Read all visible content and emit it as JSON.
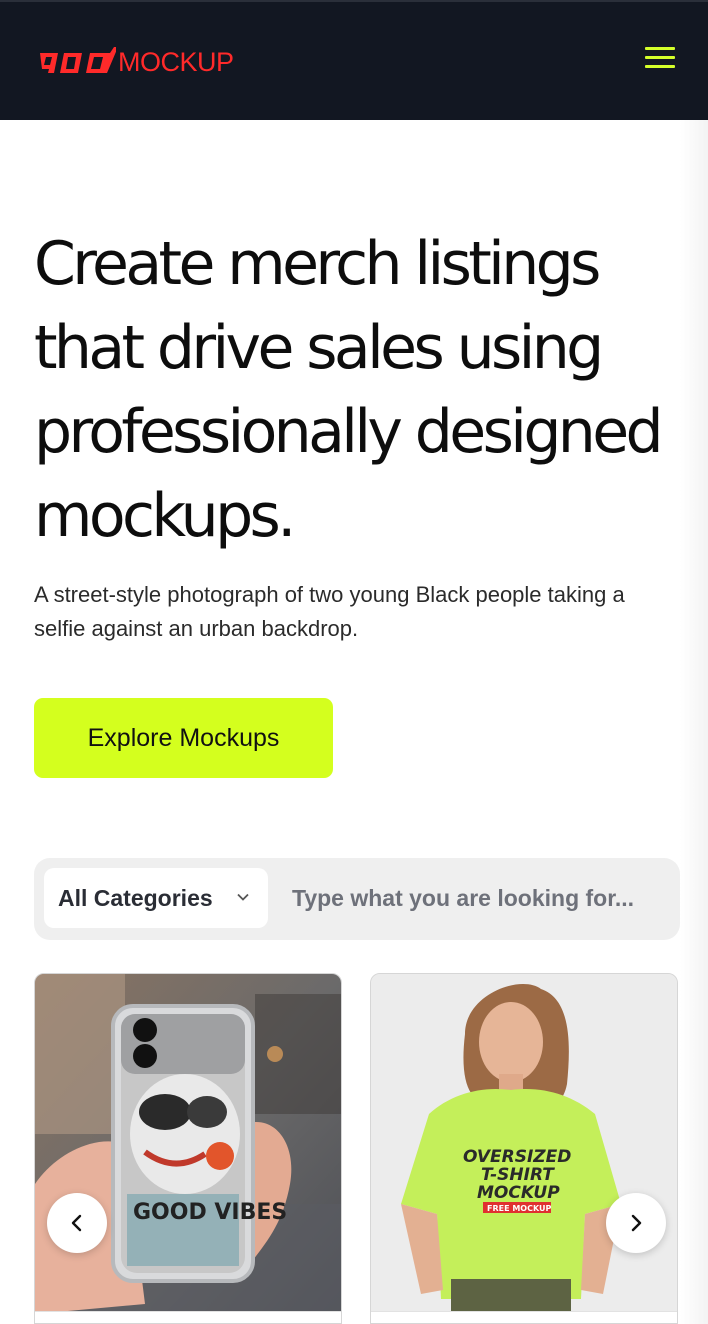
{
  "header": {
    "logo_text": "MOCKUP",
    "logo_mark": "pod",
    "menu_icon": "hamburger-menu-icon",
    "brand_color": "#ff2a2a",
    "background": "#121722"
  },
  "hero": {
    "title": "Create merch listings that drive sales using professionally designed mockups.",
    "subtitle": "A street-style photograph of two young Black people taking a selfie against an urban backdrop.",
    "cta_label": "Explore Mockups",
    "accent_color": "#d4ff1e"
  },
  "search": {
    "category_selected": "All Categories",
    "category_icon": "chevron-down-icon",
    "placeholder": "Type what you are looking for..."
  },
  "carousel": {
    "prev_icon": "chevron-left-icon",
    "next_icon": "chevron-right-icon",
    "cards": [
      {
        "name": "phone-case-mockup",
        "image": "hand holding phone case with collage art",
        "case_text": "GOOD VIBES"
      },
      {
        "name": "oversized-tshirt-mockup",
        "image": "woman wearing lime oversized t-shirt",
        "shirt_line1": "OVERSIZED",
        "shirt_line2": "T-SHIRT",
        "shirt_line3": "MOCKUP",
        "shirt_badge": "FREE MOCKUP"
      }
    ]
  }
}
